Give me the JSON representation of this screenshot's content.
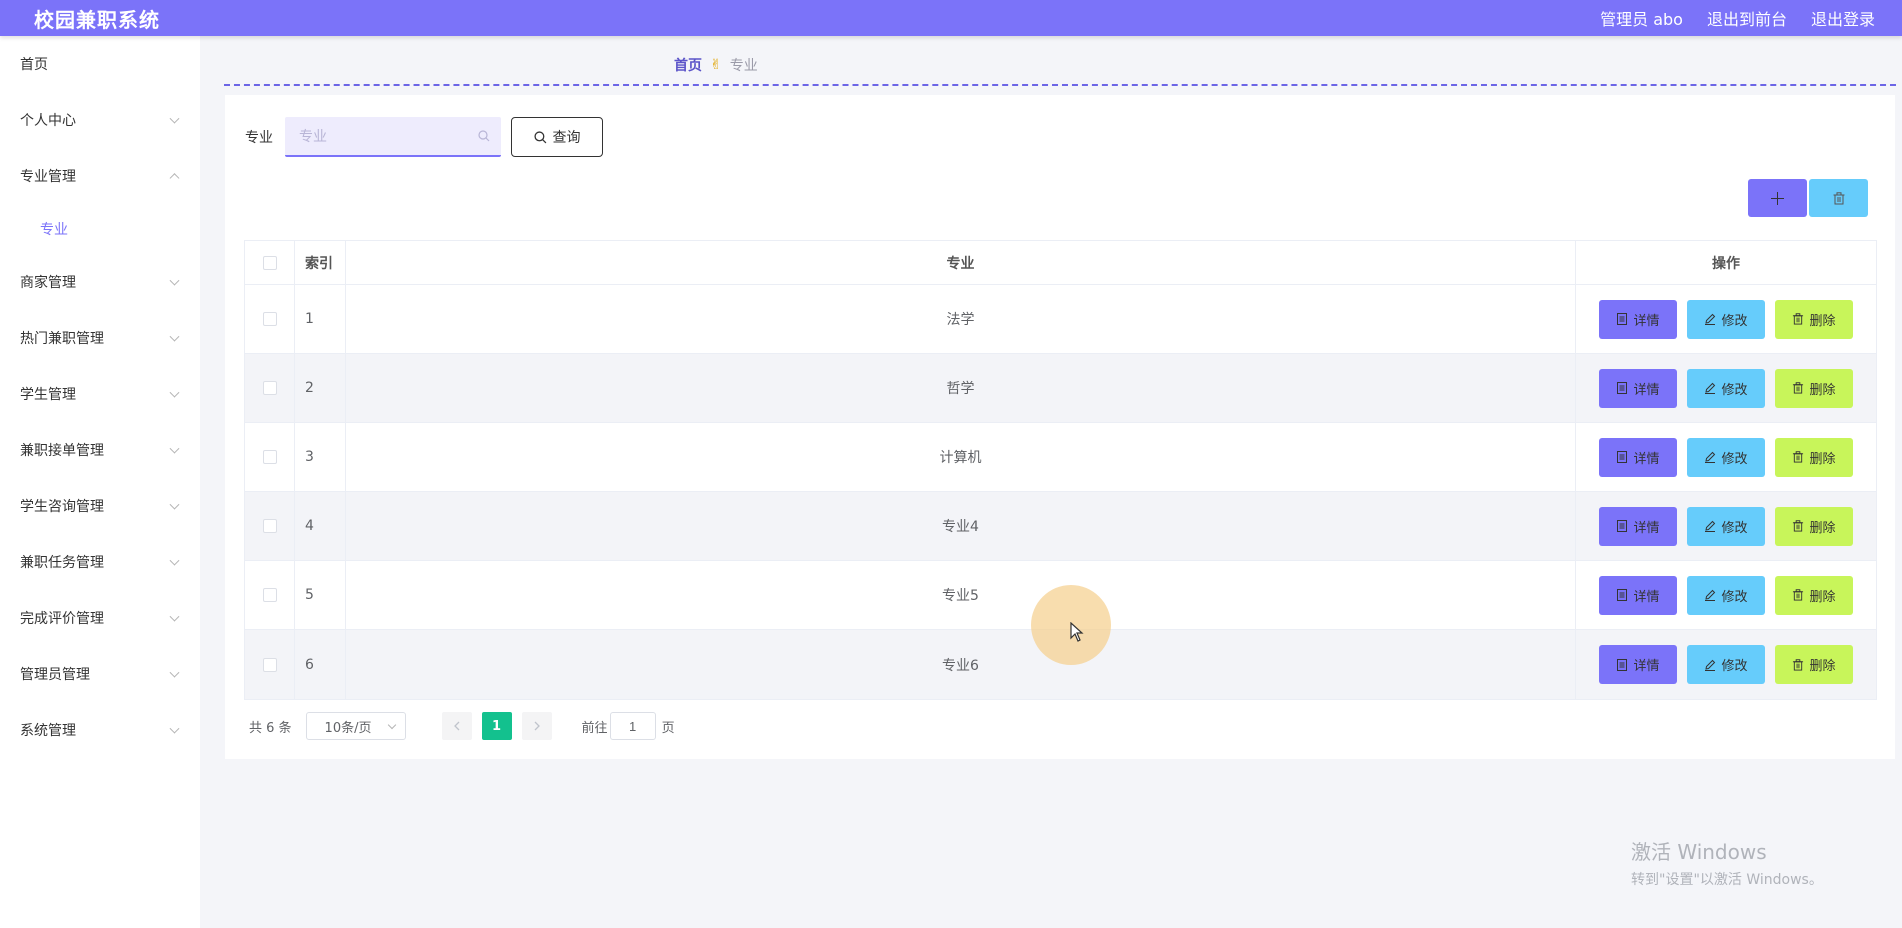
{
  "header": {
    "title": "校园兼职系统",
    "links": [
      "管理员 abo",
      "退出到前台",
      "退出登录"
    ]
  },
  "sidebar": {
    "home": "首页",
    "items": [
      {
        "label": "个人中心",
        "expanded": false
      },
      {
        "label": "专业管理",
        "expanded": true,
        "children": [
          "专业"
        ]
      },
      {
        "label": "商家管理",
        "expanded": false
      },
      {
        "label": "热门兼职管理",
        "expanded": false
      },
      {
        "label": "学生管理",
        "expanded": false
      },
      {
        "label": "兼职接单管理",
        "expanded": false
      },
      {
        "label": "学生咨询管理",
        "expanded": false
      },
      {
        "label": "兼职任务管理",
        "expanded": false
      },
      {
        "label": "完成评价管理",
        "expanded": false
      },
      {
        "label": "管理员管理",
        "expanded": false
      },
      {
        "label": "系统管理",
        "expanded": false
      }
    ]
  },
  "breadcrumb": {
    "home": "首页",
    "separator_icon": "hand-icon",
    "current": "专业"
  },
  "search": {
    "label": "专业",
    "placeholder": "专业",
    "value": "",
    "button": "查询"
  },
  "toolbar": {
    "add_icon": "plus-icon",
    "delete_icon": "trash-icon"
  },
  "table": {
    "headers": {
      "index": "索引",
      "major": "专业",
      "ops": "操作"
    },
    "rows": [
      {
        "index": "1",
        "major": "法学"
      },
      {
        "index": "2",
        "major": "哲学"
      },
      {
        "index": "3",
        "major": "计算机"
      },
      {
        "index": "4",
        "major": "专业4"
      },
      {
        "index": "5",
        "major": "专业5"
      },
      {
        "index": "6",
        "major": "专业6"
      }
    ],
    "ops": {
      "detail": "详情",
      "edit": "修改",
      "remove": "删除"
    }
  },
  "pagination": {
    "total": "共 6 条",
    "page_size": "10条/页",
    "current_page": "1",
    "goto_prefix": "前往",
    "goto_value": "1",
    "goto_suffix": "页"
  },
  "watermark": {
    "line1": "激活 Windows",
    "line2": "转到\"设置\"以激活 Windows。"
  },
  "colors": {
    "accent": "#7b73f9",
    "info": "#66ccfb",
    "danger": "#c8f55a",
    "pager_active": "#13c18e"
  }
}
